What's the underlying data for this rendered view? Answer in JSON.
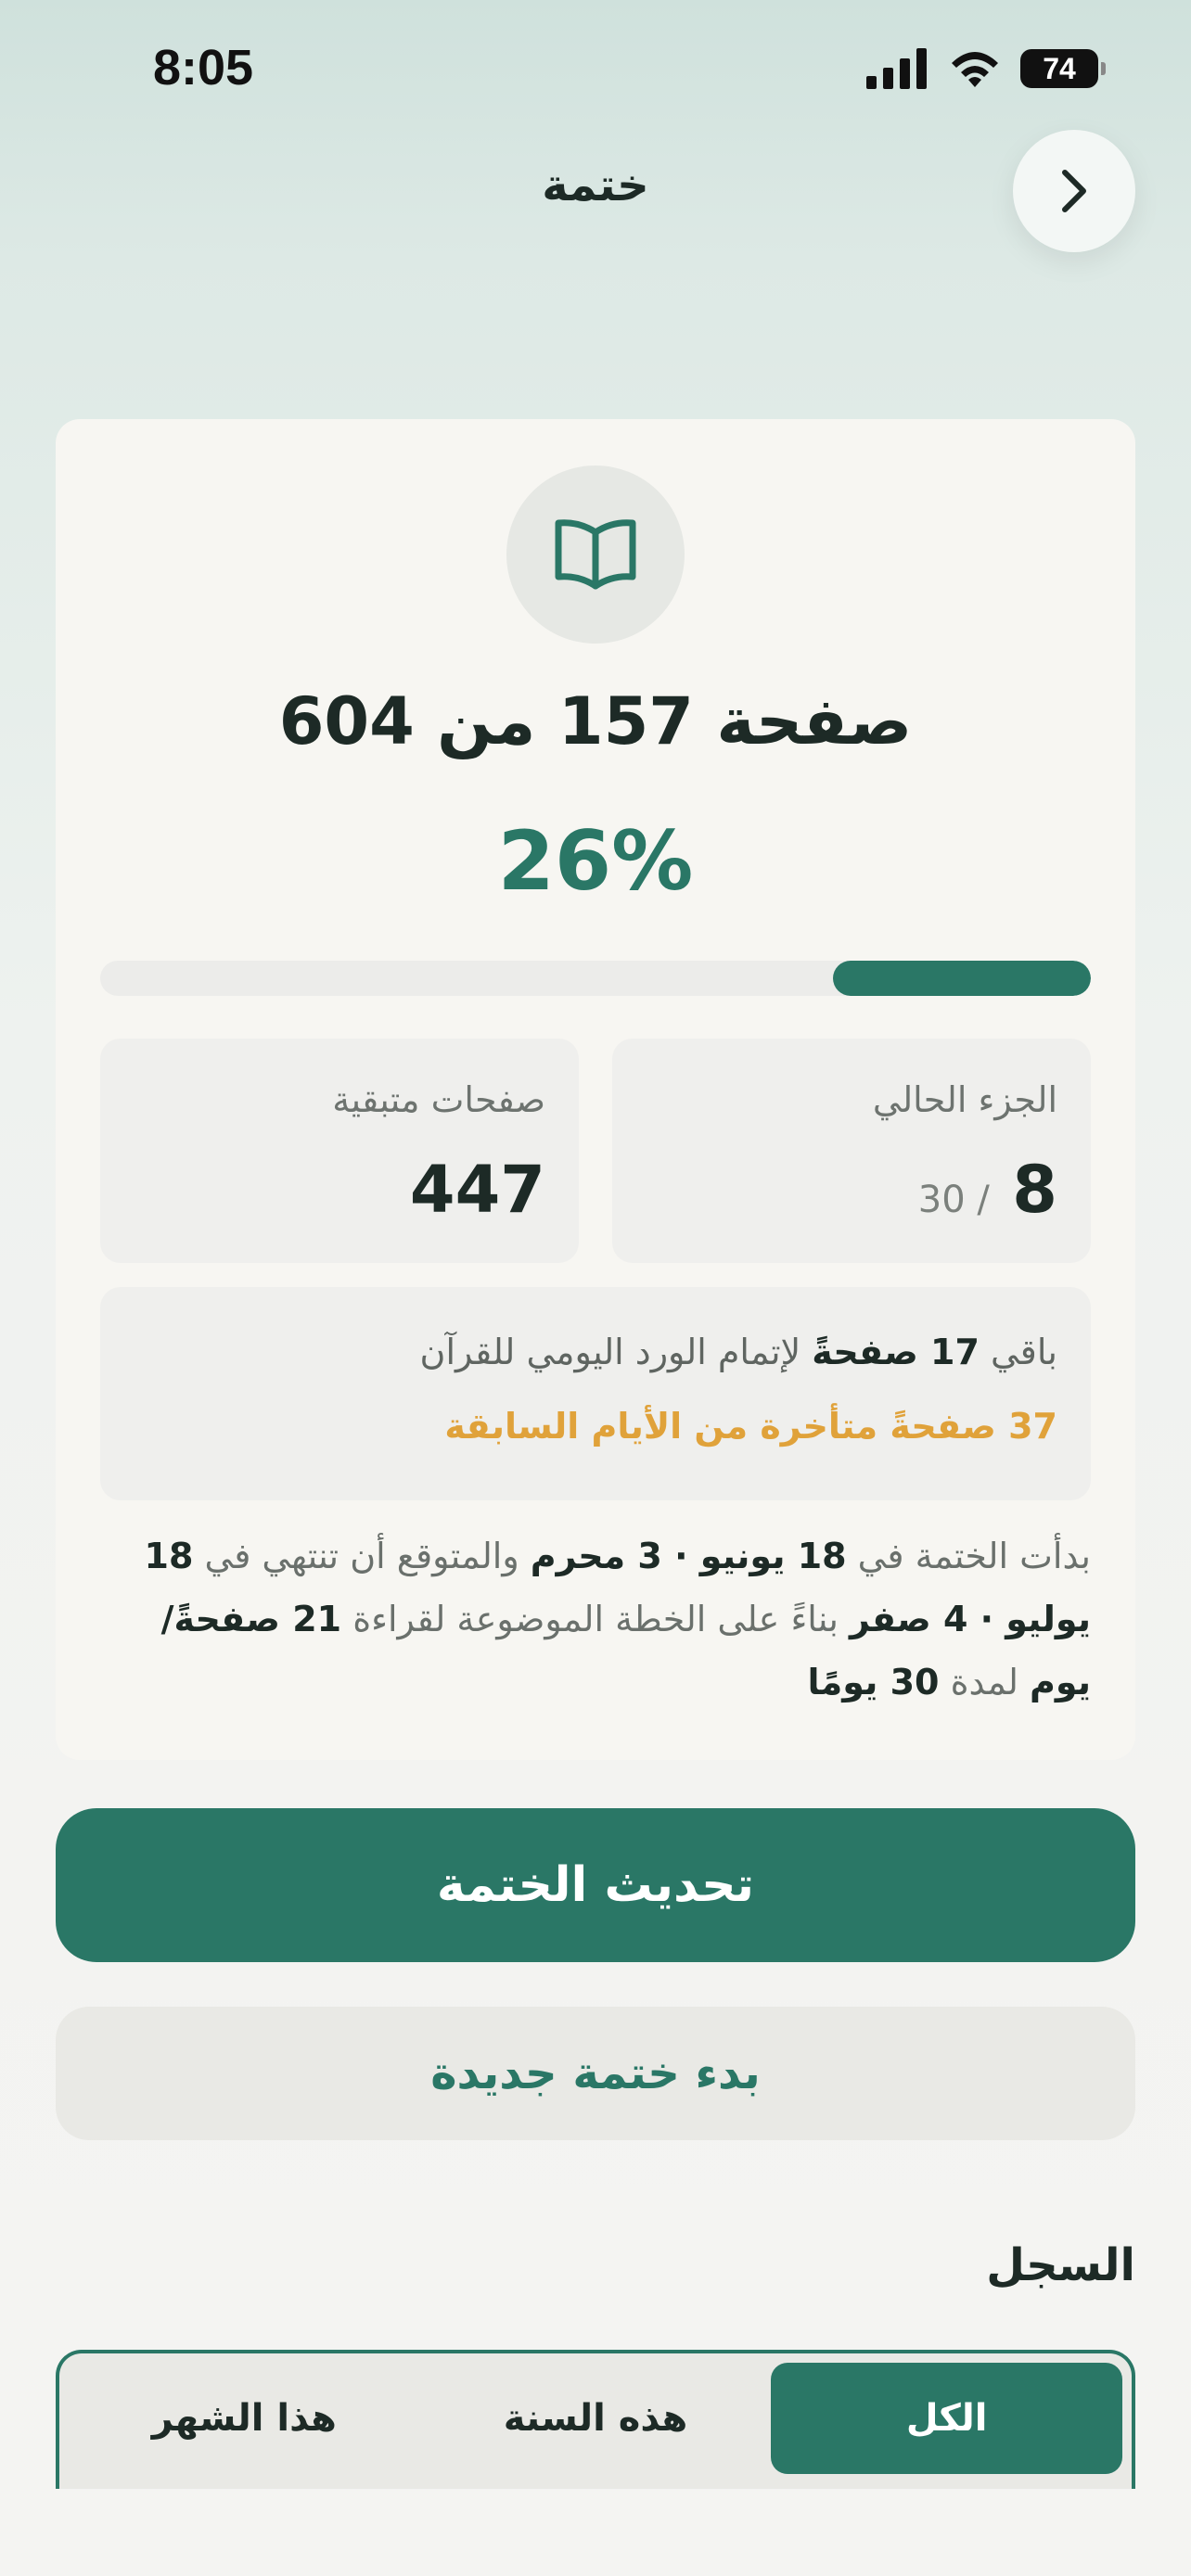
{
  "status_bar": {
    "time": "8:05",
    "battery": "74"
  },
  "nav": {
    "title": "ختمة"
  },
  "card": {
    "page_count": "صفحة 157 من 604",
    "percent": "26%",
    "progress_fraction": 0.26,
    "stats": [
      {
        "label": "الجزء الحالي",
        "value": "8",
        "sub": "/ 30"
      },
      {
        "label": "صفحات متبقية",
        "value": "447",
        "sub": ""
      }
    ],
    "info": {
      "line1_a": "باقي ",
      "line1_b": "17 صفحةً",
      "line1_c": " لإتمام الورد اليومي للقرآن",
      "line2": "37 صفحةً متأخرة من الأيام السابقة"
    },
    "description": {
      "p1": "بدأت الختمة في ",
      "d1": "18 يونيو · 3 محرم",
      "p2": " والمتوقع أن تنتهي في ",
      "d2": "18 يوليو · 4 صفر",
      "p3": " بناءً على الخطة الموضوعة لقراءة ",
      "d3": "21 صفحةً/يوم",
      "p4": " لمدة ",
      "d4": "30 يومًا"
    }
  },
  "actions": {
    "update": "تحديث الختمة",
    "new": "بدء ختمة جديدة"
  },
  "history": {
    "title": "السجل",
    "tabs": [
      {
        "label": "هذا الشهر",
        "active": false
      },
      {
        "label": "هذه السنة",
        "active": false
      },
      {
        "label": "الكل",
        "active": true
      }
    ]
  },
  "colors": {
    "accent": "#2a7766",
    "warning": "#e0a23a"
  }
}
